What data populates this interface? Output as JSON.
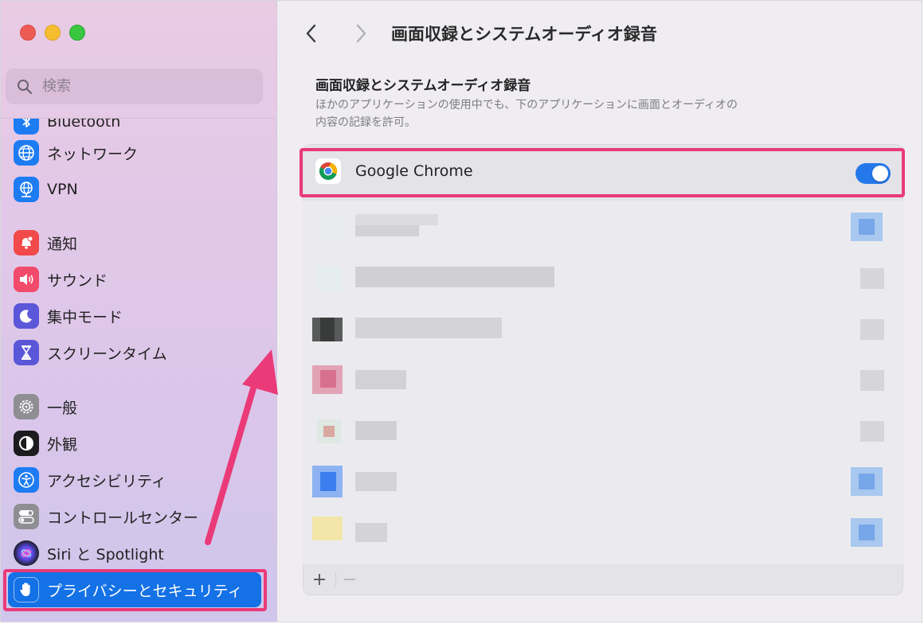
{
  "window": {
    "traffic_lights": [
      "close",
      "minimize",
      "zoom"
    ]
  },
  "sidebar": {
    "search_placeholder": "検索",
    "items": [
      {
        "label": "Bluetooth",
        "icon": "bluetooth-icon",
        "color": "#1e7cf3"
      },
      {
        "label": "ネットワーク",
        "icon": "globe-icon",
        "color": "#1e7cf3"
      },
      {
        "label": "VPN",
        "icon": "vpn-globe-icon",
        "color": "#1e7cf3"
      },
      {
        "label": "通知",
        "icon": "bell-icon",
        "color": "#f24a4a"
      },
      {
        "label": "サウンド",
        "icon": "speaker-icon",
        "color": "#f24a6a"
      },
      {
        "label": "集中モード",
        "icon": "moon-icon",
        "color": "#5b57d9"
      },
      {
        "label": "スクリーンタイム",
        "icon": "hourglass-icon",
        "color": "#5b57d9"
      },
      {
        "label": "一般",
        "icon": "gear-icon",
        "color": "#8e8e93"
      },
      {
        "label": "外観",
        "icon": "appearance-icon",
        "color": "#1c1c1e"
      },
      {
        "label": "アクセシビリティ",
        "icon": "accessibility-icon",
        "color": "#1e7cf3"
      },
      {
        "label": "コントロールセンター",
        "icon": "toggles-icon",
        "color": "#8e8e93"
      },
      {
        "label": "Siri と Spotlight",
        "icon": "siri-icon",
        "color": "#222222"
      },
      {
        "label": "プライバシーとセキュリティ",
        "icon": "hand-icon",
        "color": "#1471e6",
        "selected": true
      }
    ]
  },
  "main": {
    "title": "画面収録とシステムオーディオ録音",
    "section_title": "画面収録とシステムオーディオ録音",
    "section_desc_line1": "ほかのアプリケーションの使用中でも、下のアプリケーションに画面とオーディオの",
    "section_desc_line2": "内容の記録を許可。",
    "apps": [
      {
        "label": "Google Chrome",
        "enabled": true,
        "icon": "chrome-icon"
      }
    ],
    "footer": {
      "add": "+",
      "remove": "−"
    }
  },
  "annotations": {
    "highlight_color": "#ea3a78"
  }
}
